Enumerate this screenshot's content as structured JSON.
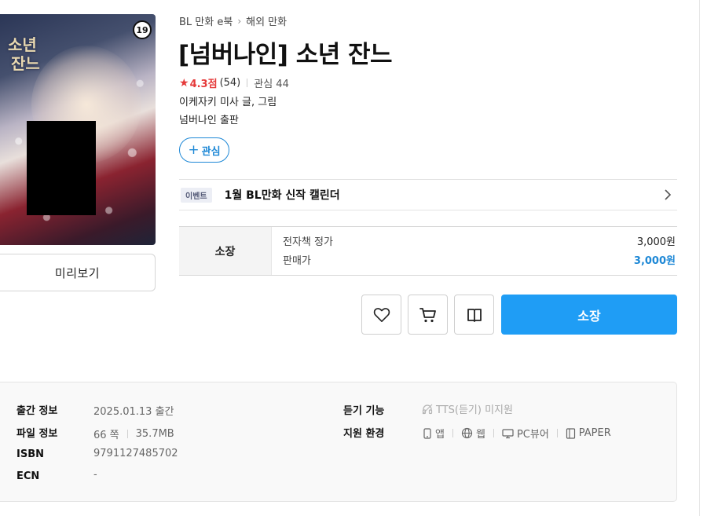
{
  "breadcrumb": {
    "category": "BL 만화 e북",
    "subcategory": "해외 만화"
  },
  "book": {
    "title": "[넘버나인] 소년 잔느",
    "age_badge": "19",
    "cover_title_mark": "소년 잔느",
    "rating": "4.3점",
    "rating_count": "(54)",
    "interest": "관심 44",
    "author": "이케자키 미사 글, 그림",
    "publisher": "넘버나인 출판"
  },
  "buttons": {
    "preview": "미리보기",
    "follow_plus": "+",
    "follow": "관심",
    "buy": "소장"
  },
  "event": {
    "badge": "이벤트",
    "text": "1월 BL만화 신작 캘린더"
  },
  "price": {
    "type_label": "소장",
    "list_label": "전자책 정가",
    "list_value": "3,000원",
    "sale_label": "판매가",
    "sale_value": "3,000원",
    "sale_color": "#1e88d6"
  },
  "meta": {
    "release_label": "출간 정보",
    "release_value": "2025.01.13 출간",
    "file_label": "파일 정보",
    "file_pages": "66 쪽",
    "file_size": "35.7MB",
    "isbn_label": "ISBN",
    "isbn_value": "9791127485702",
    "ecn_label": "ECN",
    "ecn_value": "-",
    "listen_label": "듣기 기능",
    "listen_value": "TTS(듣기) 미지원",
    "env_label": "지원 환경",
    "env_app": "앱",
    "env_web": "웹",
    "env_pc": "PC뷰어",
    "env_paper": "PAPER"
  },
  "icons": {
    "wishlist": "heart-icon",
    "cart": "cart-icon",
    "gift": "gift-icon",
    "event_arrow": "chevron-right-icon",
    "tts": "headphones-icon",
    "app": "phone-icon",
    "web": "globe-icon",
    "pc": "monitor-icon",
    "paper": "ereader-icon"
  },
  "colors": {
    "accent": "#1f9df5",
    "rating": "#e53a3a"
  }
}
